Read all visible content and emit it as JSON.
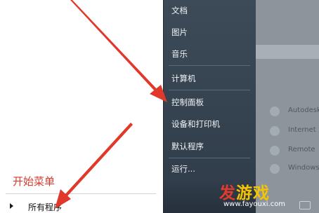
{
  "start_menu": {
    "right_column": {
      "items": [
        {
          "label": "文档"
        },
        {
          "label": "图片"
        },
        {
          "label": "音乐"
        },
        {
          "label": "计算机"
        },
        {
          "label": "控制面板"
        },
        {
          "label": "设备和打印机"
        },
        {
          "label": "默认程序"
        },
        {
          "label": "运行..."
        }
      ]
    },
    "left_column": {
      "caption": "开始菜单",
      "all_programs_label": "所有程序"
    }
  },
  "desktop_behind": {
    "labels": [
      "Autodesk",
      "Internet",
      "Remote",
      "Windows"
    ]
  },
  "watermark": {
    "title": "发游戏",
    "url": "www.fayouxi.com"
  },
  "colors": {
    "menu_dark": "#3a4654",
    "arrow_red": "#e0392b",
    "caption_red": "#d63a2e",
    "watermark_red": "#e23a2d",
    "watermark_yellow": "#f5c400"
  }
}
